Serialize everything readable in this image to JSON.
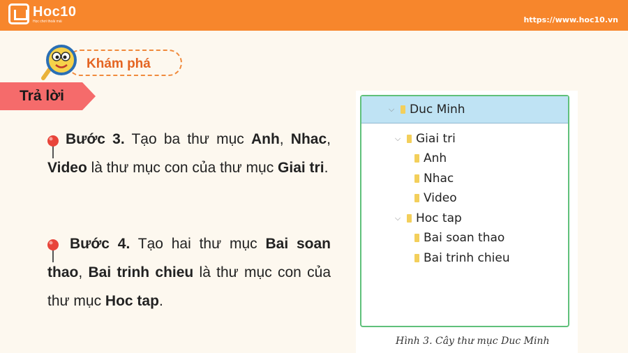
{
  "header": {
    "logo_title": "Hoc10",
    "logo_subtitle": "Học chơi thoải mái",
    "site_url": "https://www.hoc10.vn",
    "bar_color": "#f7862c"
  },
  "explore": {
    "label": "Khám phá",
    "mascot_icon": "magnifier-mascot-icon"
  },
  "answer": {
    "label": "Trả lời",
    "ribbon_color": "#f56b6b"
  },
  "step3": {
    "lead": "Bước 3.",
    "t1": " Tạo ba thư mục ",
    "b1": "Anh",
    "t2": ", ",
    "b2": "Nhac",
    "t3": ", ",
    "b3": "Video",
    "t4": " là thư mục con của thư mục ",
    "b4": "Giai tri",
    "t5": "."
  },
  "step4": {
    "lead": "Bước 4.",
    "t1": " Tạo hai thư mục ",
    "b1": "Bai soan thao",
    "t2": ", ",
    "b2": "Bai trinh chieu",
    "t3": " là thư mục con của thư mục ",
    "b3": "Hoc tap",
    "t4": "."
  },
  "tree": {
    "root": "Duc Minh",
    "giai_tri": "Giai tri",
    "anh": "Anh",
    "nhac": "Nhac",
    "video": "Video",
    "hoc_tap": "Hoc tap",
    "bai_soan_thao": "Bai soan thao",
    "bai_trinh_chieu": "Bai trinh chieu",
    "expand_glyph": "⌵",
    "folder_color": "#f3cf5b",
    "header_color": "#bfe3f4",
    "border_color": "#5fc07a"
  },
  "caption": "Hình 3. Cây thư mục Duc Minh"
}
